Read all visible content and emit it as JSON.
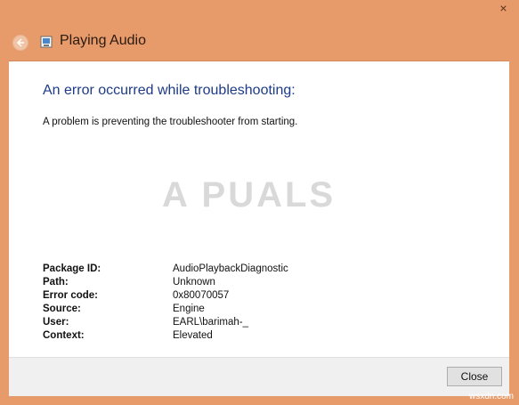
{
  "window": {
    "title": "Playing Audio",
    "close_glyph": "×"
  },
  "main": {
    "heading": "An error occurred while troubleshooting:",
    "description": "A problem is preventing the troubleshooter from starting.",
    "watermark": "A PUALS"
  },
  "details": [
    {
      "label": "Package ID:",
      "value": "AudioPlaybackDiagnostic"
    },
    {
      "label": "Path:",
      "value": "Unknown"
    },
    {
      "label": "Error code:",
      "value": "0x80070057"
    },
    {
      "label": "Source:",
      "value": "Engine"
    },
    {
      "label": "User:",
      "value": "EARL\\barimah-_"
    },
    {
      "label": "Context:",
      "value": "Elevated"
    }
  ],
  "footer": {
    "close_label": "Close"
  },
  "site_mark": "wsxdn.com",
  "colors": {
    "frame": "#e79b6b",
    "heading": "#1d3b87",
    "footer": "#f0f0f0"
  },
  "icons": {
    "back": "back-arrow-icon",
    "app": "troubleshooter-app-icon",
    "close": "close-icon"
  }
}
